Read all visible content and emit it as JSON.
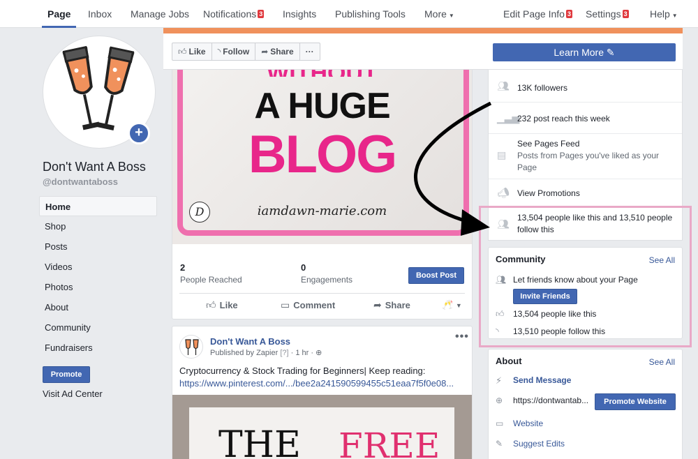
{
  "nav": {
    "page": "Page",
    "inbox": "Inbox",
    "manage_jobs": "Manage Jobs",
    "notifications": "Notifications",
    "notifications_badge": "3",
    "insights": "Insights",
    "publishing_tools": "Publishing Tools",
    "more": "More",
    "edit_page_info": "Edit Page Info",
    "edit_page_info_badge": "3",
    "settings": "Settings",
    "settings_badge": "3",
    "help": "Help"
  },
  "profile": {
    "name": "Don't Want A Boss",
    "handle": "@dontwantaboss"
  },
  "sidebar": {
    "items": [
      {
        "label": "Home"
      },
      {
        "label": "Shop"
      },
      {
        "label": "Posts"
      },
      {
        "label": "Videos"
      },
      {
        "label": "Photos"
      },
      {
        "label": "About"
      },
      {
        "label": "Community"
      },
      {
        "label": "Fundraisers"
      }
    ],
    "promote_label": "Promote",
    "ad_center_label": "Visit Ad Center"
  },
  "actionbar": {
    "like": "Like",
    "follow": "Follow",
    "share": "Share",
    "more": "···",
    "learn_more": "Learn More"
  },
  "post1": {
    "image_text_1": "WITHOUT",
    "image_text_2": "A HUGE",
    "image_text_3": "BLOG",
    "image_url": "iamdawn-marie.com",
    "image_logo": "D",
    "people_reached_value": "2",
    "people_reached_label": "People Reached",
    "engagements_value": "0",
    "engagements_label": "Engagements",
    "boost_label": "Boost Post",
    "like_label": "Like",
    "comment_label": "Comment",
    "share_label": "Share"
  },
  "post2": {
    "author": "Don't Want A Boss",
    "published_by": "Published by",
    "publisher": "Zapier",
    "help_marker": "[?]",
    "time": "1 hr",
    "text": "Cryptocurrency & Stock Trading for Beginners| Keep reading:",
    "link": "https://www.pinterest.com/.../bee2a241590599455c51eaa7f5f0e08...",
    "image_text_1": "THE",
    "image_text_2": "FREE"
  },
  "right": {
    "followers": "13K followers",
    "post_reach": "232 post reach this week",
    "pages_feed_title": "See Pages Feed",
    "pages_feed_sub": "Posts from Pages you've liked as your Page",
    "view_promotions": "View Promotions",
    "likes_follows": "13,504 people like this and 13,510 people follow this"
  },
  "community": {
    "title": "Community",
    "see_all": "See All",
    "invite_text": "Let friends know about your Page",
    "invite_button": "Invite Friends",
    "likes": "13,504 people like this",
    "follows": "13,510 people follow this"
  },
  "about": {
    "title": "About",
    "see_all": "See All",
    "send_message": "Send Message",
    "website_url": "https://dontwantab...",
    "promote_website": "Promote Website",
    "website": "Website",
    "suggest_edits": "Suggest Edits"
  },
  "colors": {
    "brand_blue": "#4267b2",
    "link_blue": "#385898",
    "badge_red": "#e0393e",
    "highlight_pink": "#e9a9c7",
    "cover_orange": "#f0915c",
    "image_pink": "#e8268a"
  }
}
